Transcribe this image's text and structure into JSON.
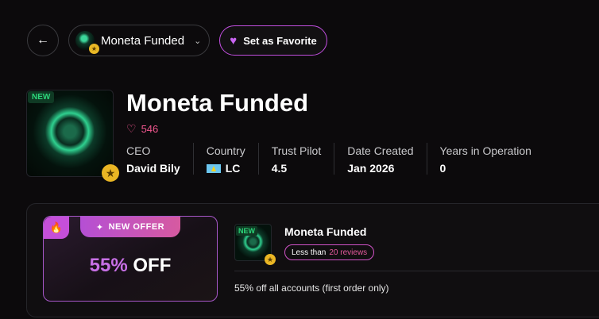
{
  "topbar": {
    "back_icon": "arrow-left-icon",
    "selected_firm": "Moneta Funded",
    "favorite_label": "Set as Favorite"
  },
  "firm": {
    "badge": "NEW",
    "name": "Moneta Funded",
    "likes": "546",
    "stats": [
      {
        "label": "CEO",
        "value": "David Bily"
      },
      {
        "label": "Country",
        "value": "LC"
      },
      {
        "label": "Trust Pilot",
        "value": "4.5"
      },
      {
        "label": "Date Created",
        "value": "Jan 2026"
      },
      {
        "label": "Years in Operation",
        "value": "0"
      }
    ]
  },
  "offer": {
    "tag": "NEW OFFER",
    "percent": "55%",
    "off": "OFF",
    "firm_badge": "NEW",
    "firm_name": "Moneta Funded",
    "reviews_prefix": "Less than",
    "reviews_count": "20 reviews",
    "description": "55% off all accounts (first order only)"
  },
  "colors": {
    "accent": "#c24fe0",
    "like": "#f0568e",
    "badge_green": "#2cd67a",
    "star_gold": "#eab624"
  }
}
